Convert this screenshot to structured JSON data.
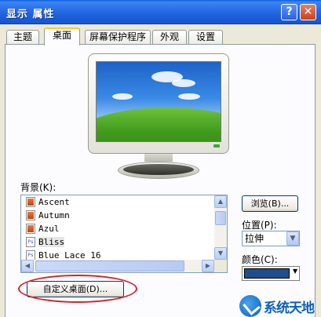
{
  "window": {
    "title": "显示 属性",
    "help_label": "?",
    "close_label": "✕"
  },
  "tabs": [
    {
      "label": "主题",
      "active": false
    },
    {
      "label": "桌面",
      "active": true
    },
    {
      "label": "屏幕保护程序",
      "active": false
    },
    {
      "label": "外观",
      "active": false
    },
    {
      "label": "设置",
      "active": false
    }
  ],
  "background": {
    "label": "背景(K):",
    "items": [
      {
        "name": "Ascent",
        "icon": "image-file-icon"
      },
      {
        "name": "Autumn",
        "icon": "image-file-icon"
      },
      {
        "name": "Azul",
        "icon": "image-file-icon"
      },
      {
        "name": "Bliss",
        "icon": "ps-file-icon",
        "selected": true
      },
      {
        "name": "Blue Lace 16",
        "icon": "ps-file-icon"
      }
    ]
  },
  "buttons": {
    "browse": "浏览(B)...",
    "customize_desktop": "自定义桌面(D)..."
  },
  "position": {
    "label": "位置(P):",
    "value": "拉伸"
  },
  "color": {
    "label": "颜色(C):",
    "value": "#1f4e8c"
  },
  "watermark": {
    "text": "系统天地"
  }
}
